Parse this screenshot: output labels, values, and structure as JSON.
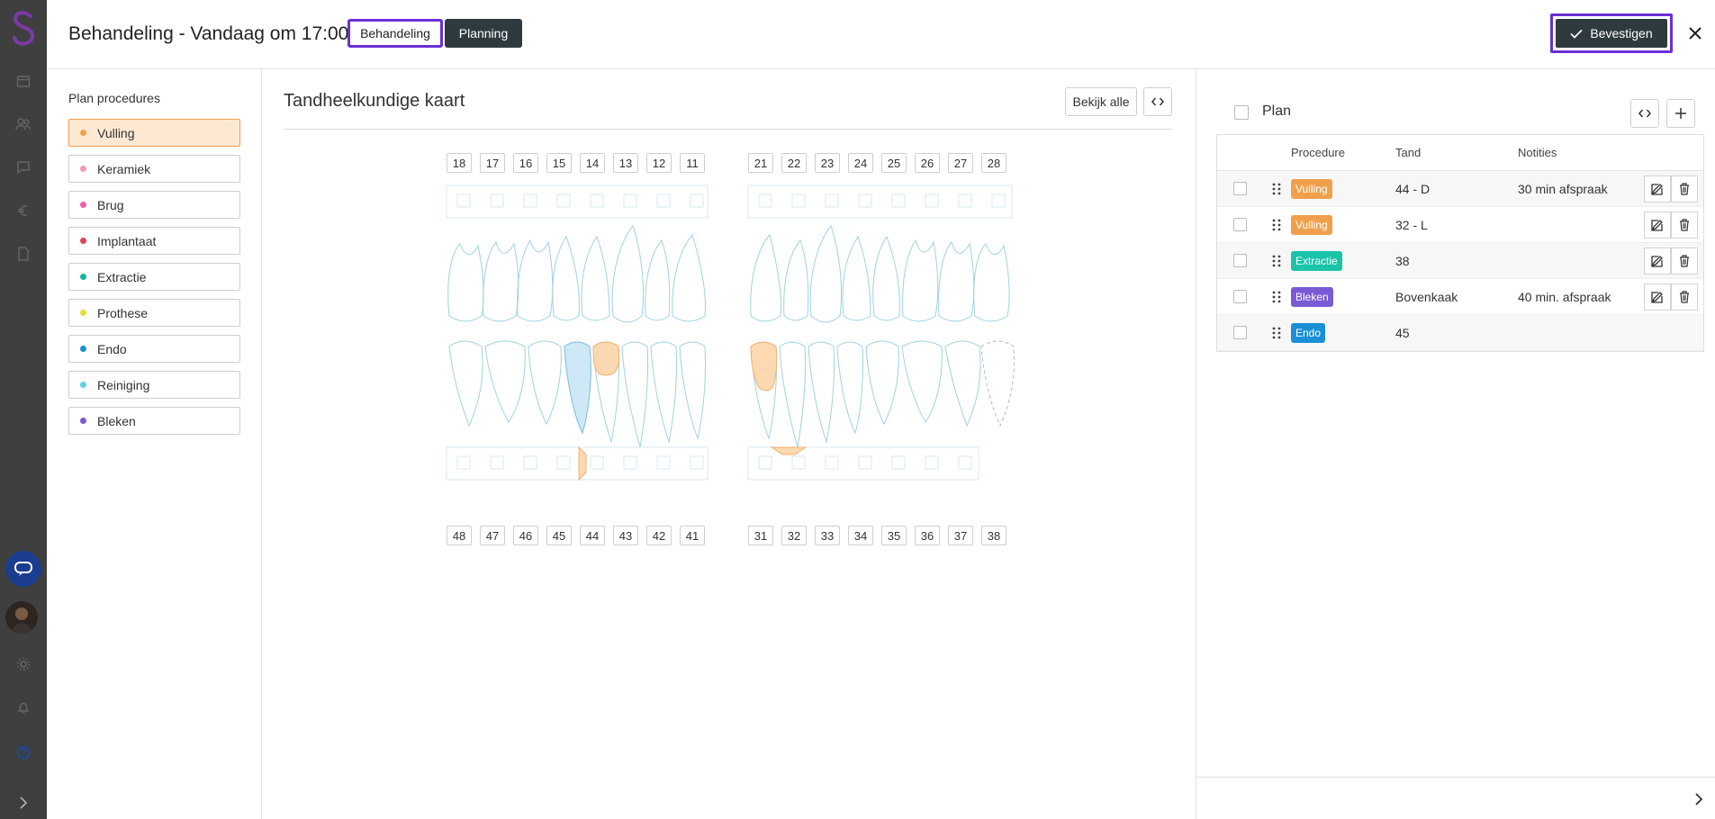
{
  "header": {
    "title": "Behandeling - Vandaag om 17:00",
    "tabs": [
      {
        "label": "Behandeling",
        "active": true
      },
      {
        "label": "Planning",
        "active": false
      }
    ],
    "confirm_label": "Bevestigen"
  },
  "procedures": {
    "title": "Plan procedures",
    "items": [
      {
        "label": "Vulling",
        "color": "#f0a04a",
        "active": true
      },
      {
        "label": "Keramiek",
        "color": "#f49ab0"
      },
      {
        "label": "Brug",
        "color": "#ef5fa7"
      },
      {
        "label": "Implantaat",
        "color": "#e0405a"
      },
      {
        "label": "Extractie",
        "color": "#19b4a0"
      },
      {
        "label": "Prothese",
        "color": "#e8dc3a"
      },
      {
        "label": "Endo",
        "color": "#1a8fd6"
      },
      {
        "label": "Reiniging",
        "color": "#5fd2e0"
      },
      {
        "label": "Bleken",
        "color": "#7b5ad6"
      }
    ]
  },
  "chart": {
    "title": "Tandheelkundige kaart",
    "view_all_label": "Bekijk alle",
    "upper_right_quadrant": [
      "18",
      "17",
      "16",
      "15",
      "14",
      "13",
      "12",
      "11"
    ],
    "upper_left_quadrant": [
      "21",
      "22",
      "23",
      "24",
      "25",
      "26",
      "27",
      "28"
    ],
    "lower_right_quadrant": [
      "48",
      "47",
      "46",
      "45",
      "44",
      "43",
      "42",
      "41"
    ],
    "lower_left_quadrant": [
      "31",
      "32",
      "33",
      "34",
      "35",
      "36",
      "37",
      "38"
    ]
  },
  "plan": {
    "title": "Plan",
    "columns": [
      "Procedure",
      "Tand",
      "Notities"
    ],
    "rows": [
      {
        "procedure": "Vulling",
        "color": "#f0a04a",
        "tooth": "44 - D",
        "notes": "30 min afspraak"
      },
      {
        "procedure": "Vulling",
        "color": "#f0a04a",
        "tooth": "32 - L",
        "notes": ""
      },
      {
        "procedure": "Extractie",
        "color": "#19c4a8",
        "tooth": "38",
        "notes": ""
      },
      {
        "procedure": "Bleken",
        "color": "#7b5ad6",
        "tooth": "Bovenkaak",
        "notes": "40 min. afspraak"
      },
      {
        "procedure": "Endo",
        "color": "#1a8fd6",
        "tooth": "45",
        "notes": ""
      }
    ]
  }
}
